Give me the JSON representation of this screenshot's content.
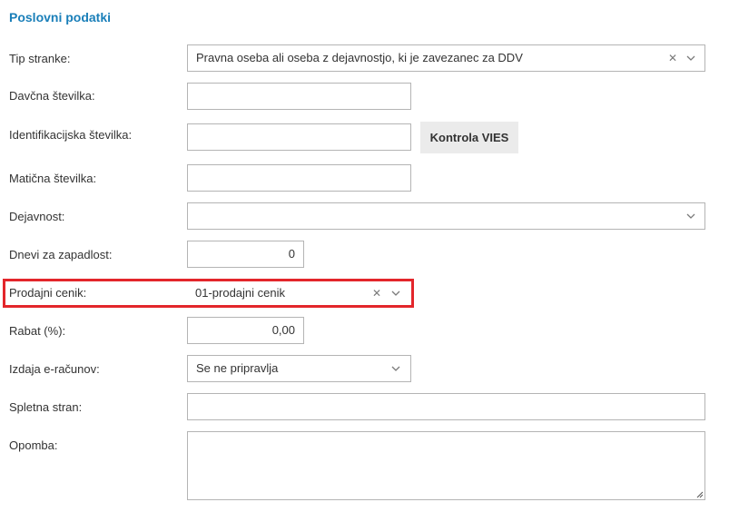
{
  "section": {
    "title": "Poslovni podatki"
  },
  "fields": {
    "tip_stranke": {
      "label": "Tip stranke:",
      "value": "Pravna oseba ali oseba z dejavnostjo, ki je zavezanec za DDV"
    },
    "davcna": {
      "label": "Davčna številka:",
      "value": ""
    },
    "identifikacijska": {
      "label": "Identifikacijska številka:",
      "value": ""
    },
    "vies_button": "Kontrola VIES",
    "maticna": {
      "label": "Matična številka:",
      "value": ""
    },
    "dejavnost": {
      "label": "Dejavnost:",
      "value": ""
    },
    "zapadlost": {
      "label": "Dnevi za zapadlost:",
      "value": "0"
    },
    "cenik": {
      "label": "Prodajni cenik:",
      "value": "01-prodajni cenik"
    },
    "rabat": {
      "label": "Rabat (%):",
      "value": "0,00"
    },
    "eracun": {
      "label": "Izdaja e-računov:",
      "value": "Se ne pripravlja"
    },
    "spletna": {
      "label": "Spletna stran:",
      "value": ""
    },
    "opomba": {
      "label": "Opomba:",
      "value": ""
    }
  },
  "icons": {
    "clear": "clear-icon",
    "chevron": "chevron-down-icon",
    "resize": "resize-handle-icon"
  },
  "colors": {
    "title": "#1a7fb9",
    "highlight": "#e3262b",
    "border": "#b4b4b4",
    "button_bg": "#ebebeb"
  }
}
